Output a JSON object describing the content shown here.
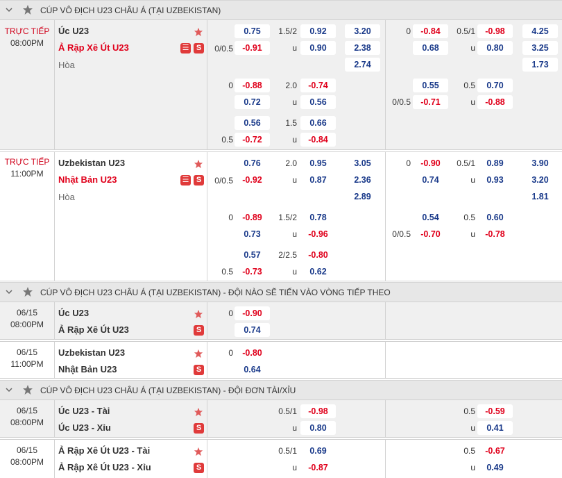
{
  "sections": [
    {
      "title": "CÚP VÔ ĐỊCH U23 CHÂU Á (TẠI UZBEKISTAN)"
    },
    {
      "title": "CÚP VÔ ĐỊCH U23 CHÂU Á (TẠI UZBEKISTAN) - ĐỘI NÀO SẼ TIẾN VÀO VÒNG TIẾP THEO"
    },
    {
      "title": "CÚP VÔ ĐỊCH U23 CHÂU Á (TẠI UZBEKISTAN) - ĐỘI ĐƠN TÀI/XỈU"
    }
  ],
  "labels": {
    "live": "TRỰC TIẾP",
    "draw": "Hòa",
    "under": "u",
    "s": "S"
  },
  "m1": {
    "time": "08:00PM",
    "home": "Úc U23",
    "away": "Ả Rập Xê Út U23",
    "ft_hcap": [
      "0/0.5",
      "0",
      "",
      "0.5"
    ],
    "ft_hcap_odds": [
      [
        "0.75",
        "-0.91"
      ],
      [
        "-0.88",
        "0.72"
      ],
      [
        "0.56",
        "-0.72"
      ]
    ],
    "ft_ou": [
      "1.5/2",
      "2.0",
      "1.5"
    ],
    "ft_ou_odds": [
      [
        "0.92",
        "0.90"
      ],
      [
        "-0.74",
        "0.56"
      ],
      [
        "0.66",
        "-0.84"
      ]
    ],
    "ft_1x2": [
      "3.20",
      "2.38",
      "2.74"
    ],
    "h1_hcap": [
      "0",
      "0/0.5"
    ],
    "h1_hcap_odds": [
      [
        "-0.84",
        "0.68"
      ],
      [
        "0.55",
        "-0.71"
      ]
    ],
    "h1_ou": [
      "0.5/1",
      "0.5"
    ],
    "h1_ou_odds": [
      [
        "-0.98",
        "0.80"
      ],
      [
        "0.70",
        "-0.88"
      ]
    ],
    "h1_1x2": [
      "4.25",
      "3.25",
      "1.73"
    ]
  },
  "m2": {
    "time": "11:00PM",
    "home": "Uzbekistan U23",
    "away": "Nhật Bản U23",
    "ft_hcap": [
      "0/0.5",
      "0",
      "0.5"
    ],
    "ft_hcap_odds": [
      [
        "0.76",
        "-0.92"
      ],
      [
        "-0.89",
        "0.73"
      ],
      [
        "0.57",
        "-0.73"
      ]
    ],
    "ft_ou": [
      "2.0",
      "1.5/2",
      "2/2.5"
    ],
    "ft_ou_odds": [
      [
        "0.95",
        "0.87"
      ],
      [
        "0.78",
        "-0.96"
      ],
      [
        "-0.80",
        "0.62"
      ]
    ],
    "ft_1x2": [
      "3.05",
      "2.36",
      "2.89"
    ],
    "h1_hcap": [
      "0",
      "0/0.5"
    ],
    "h1_hcap_odds": [
      [
        "-0.90",
        "0.74"
      ],
      [
        "0.54",
        "-0.70"
      ]
    ],
    "h1_ou": [
      "0.5/1",
      "0.5"
    ],
    "h1_ou_odds": [
      [
        "0.89",
        "0.93"
      ],
      [
        "0.60",
        "-0.78"
      ]
    ],
    "h1_1x2": [
      "3.90",
      "3.20",
      "1.81"
    ]
  },
  "q1": {
    "date": "06/15",
    "time": "08:00PM",
    "home": "Úc U23",
    "away": "Ả Rập Xê Út U23",
    "hcap": "0",
    "odds": [
      "-0.90",
      "0.74"
    ]
  },
  "q2": {
    "date": "06/15",
    "time": "11:00PM",
    "home": "Uzbekistan U23",
    "away": "Nhật Bản U23",
    "hcap": "0",
    "odds": [
      "-0.80",
      "0.64"
    ]
  },
  "t1": {
    "date": "06/15",
    "time": "08:00PM",
    "home": "Úc U23 - Tài",
    "away": "Úc U23 - Xỉu",
    "ft_line": "0.5/1",
    "ft_odds": [
      "-0.98",
      "0.80"
    ],
    "h1_line": "0.5",
    "h1_odds": [
      "-0.59",
      "0.41"
    ]
  },
  "t2": {
    "date": "06/15",
    "time": "08:00PM",
    "home": "Ả Rập Xê Út U23 - Tài",
    "away": "Ả Rập Xê Út U23 - Xỉu",
    "ft_line": "0.5/1",
    "ft_odds": [
      "0.69",
      "-0.87"
    ],
    "h1_line": "0.5",
    "h1_odds": [
      "-0.67",
      "0.49"
    ]
  }
}
